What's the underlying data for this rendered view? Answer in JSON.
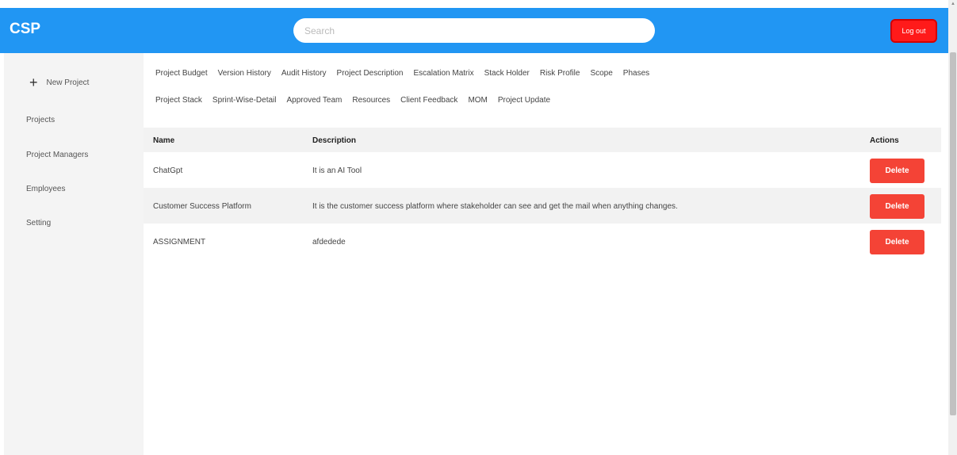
{
  "app": {
    "logo": "CSP"
  },
  "header": {
    "search_placeholder": "Search",
    "logout_label": "Log out"
  },
  "sidebar": {
    "new_project": "New Project",
    "items": [
      "Projects",
      "Project Managers",
      "Employees",
      "Setting"
    ]
  },
  "tabs": {
    "row1": [
      "Project Budget",
      "Version History",
      "Audit History",
      "Project Description",
      "Escalation Matrix",
      "Stack Holder",
      "Risk Profile",
      "Scope",
      "Phases"
    ],
    "row2": [
      "Project Stack",
      "Sprint-Wise-Detail",
      "Approved Team",
      "Resources",
      "Client Feedback",
      "MOM",
      "Project Update"
    ]
  },
  "table": {
    "headers": {
      "name": "Name",
      "description": "Description",
      "actions": "Actions"
    },
    "rows": [
      {
        "name": "ChatGpt",
        "description": "It is an AI Tool",
        "action": "Delete"
      },
      {
        "name": "Customer Success Platform",
        "description": "It is the customer success platform where stakeholder can see and get the mail when anything changes.",
        "action": "Delete"
      },
      {
        "name": "ASSIGNMENT",
        "description": "afdedede",
        "action": "Delete"
      }
    ]
  },
  "colors": {
    "header": "#2196f3",
    "logout": "#ff1a1a",
    "delete": "#f44336"
  }
}
